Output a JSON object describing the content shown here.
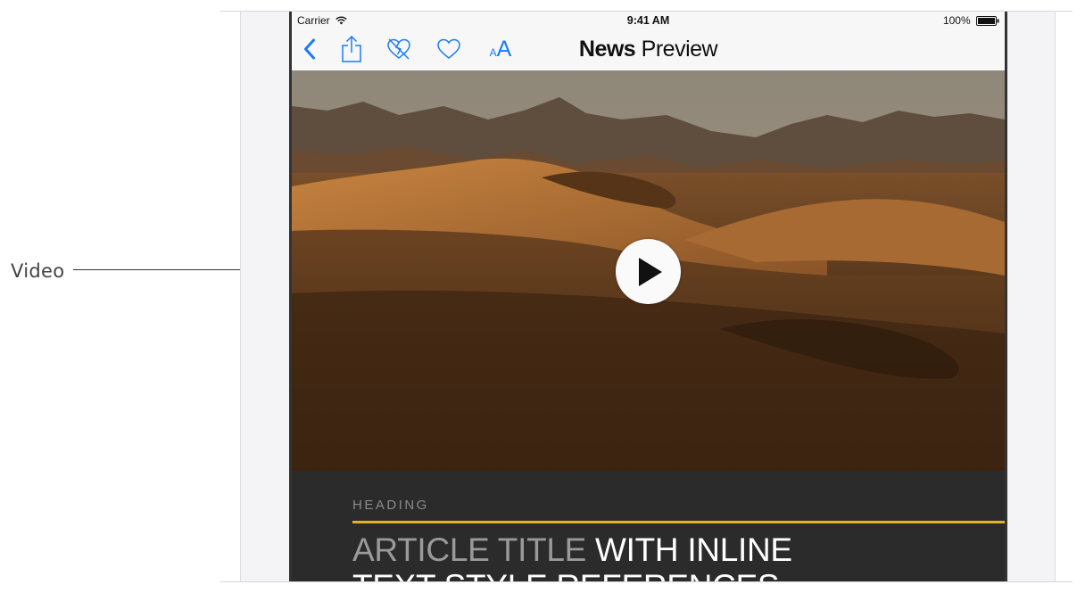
{
  "callout": {
    "label": "Video"
  },
  "status_bar": {
    "carrier": "Carrier",
    "time": "9:41 AM",
    "battery": "100%"
  },
  "nav_bar": {
    "title_bold": "News",
    "title_light": " Preview",
    "text_size_small": "A",
    "text_size_large": "A",
    "icons": [
      "back-chevron-icon",
      "share-icon",
      "dislike-heart-icon",
      "heart-icon",
      "text-size-icon"
    ],
    "accent_color": "#1a7cf5"
  },
  "video": {
    "icon": "play-icon"
  },
  "article": {
    "heading": "HEADING",
    "title_muted": "ARTICLE TITLE",
    "title_line1": " WITH INLINE",
    "title_line2": "TEXT STYLE REFERENCES",
    "rule_color": "#e0b22c",
    "background": "#2b2b2b"
  }
}
